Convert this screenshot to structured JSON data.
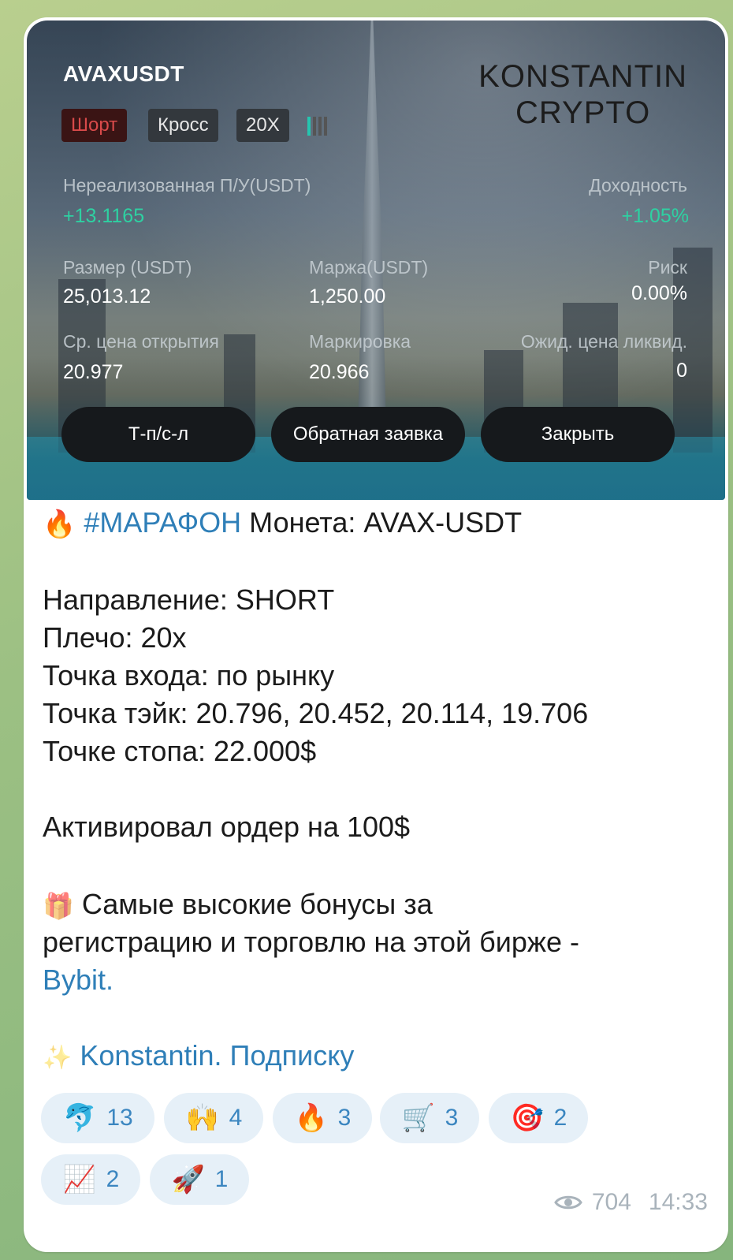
{
  "card": {
    "pair": "AVAXUSDT",
    "brand_line1": "KONSTANTIN",
    "brand_line2": "CRYPTO",
    "tags": {
      "direction": "Шорт",
      "margin_mode": "Кросс",
      "leverage": "20X"
    },
    "unrealized_label": "Нереализованная П/У(USDT)",
    "unrealized_value": "+13.1165",
    "yield_label": "Доходность",
    "yield_value": "+1.05%",
    "size_label": "Размер (USDT)",
    "size_value": "25,013.12",
    "margin_label": "Маржа(USDT)",
    "margin_value": "1,250.00",
    "risk_label": "Риск",
    "risk_value": "0.00%",
    "entry_label": "Ср. цена открытия",
    "entry_value": "20.977",
    "mark_label": "Маркировка",
    "mark_value": "20.966",
    "liq_label": "Ожид. цена ликвид.",
    "liq_value": "0",
    "buttons": {
      "tpsl": "Т-п/с-л",
      "reverse": "Обратная заявка",
      "close": "Закрыть"
    }
  },
  "message": {
    "hashtag": "#МАРАФОН",
    "coin_line": " Монета: AVAX-USDT",
    "direction": "Направление: SHORT",
    "leverage": "Плечо: 20x",
    "entry": "Точка входа: по рынку",
    "takes": "Точка тэйк: 20.796, 20.452, 20.114, 19.706",
    "stop": "Точке стопа: 22.000$",
    "order": "Активировал ордер на 100$",
    "bonus_line1": "Самые высокие бонусы за",
    "bonus_line2": "регистрацию и торговлю на этой бирже -",
    "bybit_link": "Bybit.",
    "subscribe_link": "Konstantin. Подписку"
  },
  "reactions": [
    {
      "icon": "dolphin-icon",
      "glyph": "🐬",
      "count": "13"
    },
    {
      "icon": "hands-icon",
      "glyph": "🙌",
      "count": "4"
    },
    {
      "icon": "fire-icon",
      "glyph": "🔥",
      "count": "3"
    },
    {
      "icon": "buy-icon",
      "glyph": "🛒",
      "count": "3"
    },
    {
      "icon": "target-icon",
      "glyph": "🎯",
      "count": "2"
    },
    {
      "icon": "chart-up-icon",
      "glyph": "📈",
      "count": "2"
    },
    {
      "icon": "rocket-icon",
      "glyph": "🚀",
      "count": "1"
    }
  ],
  "meta": {
    "views": "704",
    "time": "14:33"
  },
  "colors": {
    "accent_link": "#2f7fb8",
    "profit_green": "#2ed1a2",
    "short_red": "#d94a4a",
    "reaction_bg": "#e6f0f8"
  }
}
